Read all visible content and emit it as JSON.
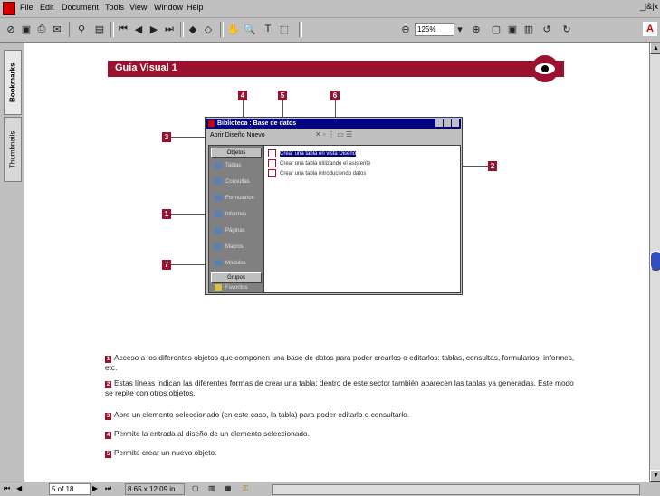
{
  "menubar": {
    "items": [
      "File",
      "Edit",
      "Document",
      "Tools",
      "View",
      "Window",
      "Help"
    ],
    "window_controls": "_|&|x"
  },
  "toolbar": {
    "zoom": "125%"
  },
  "left_tabs": {
    "bookmarks": "Bookmarks",
    "thumbnails": "Thumbnails"
  },
  "page": {
    "title": "Guia Visual 1",
    "callouts": [
      "4",
      "5",
      "6",
      "3",
      "2",
      "1",
      "7"
    ],
    "window": {
      "title": "Biblioteca : Base de datos",
      "toolbar_text": "Abrir  Diseño  Nuevo",
      "side_header": "Objetos",
      "side_items": [
        "Tablas",
        "Consultas",
        "Formularios",
        "Informes",
        "Páginas",
        "Macros",
        "Módulos"
      ],
      "side_footer": "Grupos",
      "side_footer_item": "Favoritos",
      "main_items": [
        "Crear una tabla en vista Diseño",
        "Crear una tabla utilizando el asistente",
        "Crear una tabla introduciendo datos"
      ]
    },
    "paragraphs": [
      {
        "num": "1",
        "text": "Acceso a los diferentes objetos que componen una base de datos para poder crearlos o editarlos: tablas, consultas, formularios, informes, etc."
      },
      {
        "num": "2",
        "text": "Estas líneas indican las diferentes formas de crear una tabla; dentro de este sector también aparecen las tablas ya generadas. Este modo se repite con otros objetos."
      },
      {
        "num": "3",
        "text": "Abre un elemento seleccionado (en este caso, la tabla) para poder editarlo o consultarlo."
      },
      {
        "num": "4",
        "text": "Permite la entrada al diseño de un elemento seleccionado."
      },
      {
        "num": "5",
        "text": "Permite crear un nuevo objeto."
      }
    ]
  },
  "statusbar": {
    "page": "5 of 18",
    "size": "8.65 x 12.09 in"
  },
  "colors": {
    "accent": "#9c1030",
    "window_title": "#000080"
  }
}
